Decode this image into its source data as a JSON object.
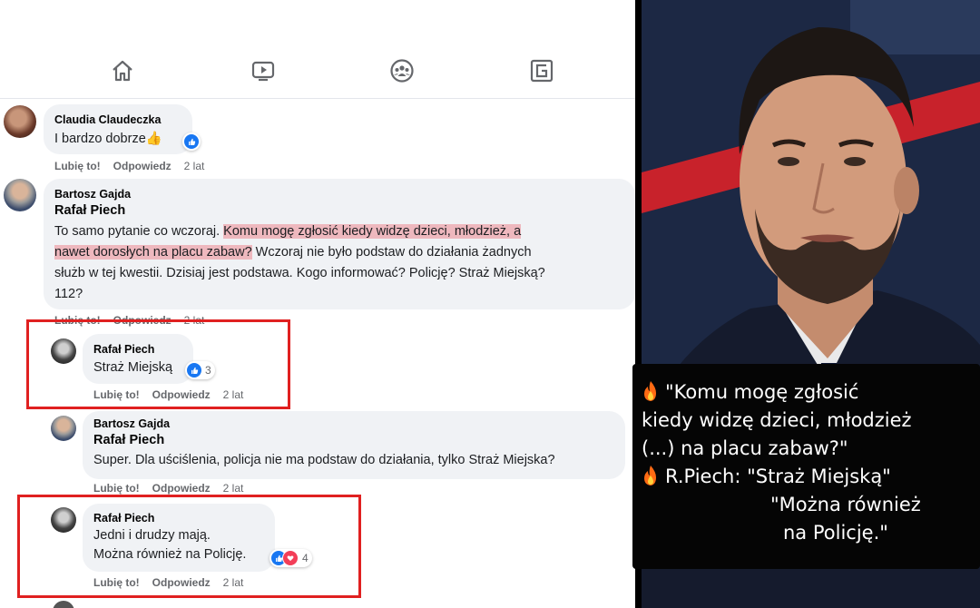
{
  "nav": {
    "icons": [
      "home-icon",
      "video-icon",
      "groups-icon",
      "gaming-icon"
    ]
  },
  "comments": [
    {
      "author": "Claudia Claudeczka",
      "text": "I bardzo dobrze👍",
      "actions": {
        "like": "Lubię to!",
        "reply": "Odpowiedz",
        "time": "2 lat"
      }
    },
    {
      "author": "Bartosz Gajda",
      "mention": "Rafał Piech",
      "lines": [
        "To samo pytanie co wczoraj.",
        "Komu mogę zgłosić kiedy widzę dzieci, młodzież, a",
        "nawet dorosłych na placu zabaw?",
        " Wczoraj nie było podstaw do działania żadnych",
        "służb w tej kwestii. Dzisiaj jest podstawa. Kogo informować? Policję? Straż Miejską?",
        "112?"
      ],
      "actions": {
        "like": "Lubię to!",
        "reply": "Odpowiedz",
        "time": "2 lat"
      }
    },
    {
      "author": "Rafał Piech",
      "text": "Straż Miejską",
      "reactions": "3",
      "actions": {
        "like": "Lubię to!",
        "reply": "Odpowiedz",
        "time": "2 lat"
      }
    },
    {
      "author": "Bartosz Gajda",
      "mention": "Rafał Piech",
      "text": "Super. Dla uściślenia, policja nie ma podstaw do działania, tylko Straż Miejska?",
      "actions": {
        "like": "Lubię to!",
        "reply": "Odpowiedz",
        "time": "2 lat"
      }
    },
    {
      "author": "Rafał Piech",
      "lines": [
        "Jedni i drudzy mają.",
        "Można również na Policję."
      ],
      "reactions": "4",
      "actions": {
        "like": "Lubię to!",
        "reply": "Odpowiedz",
        "time": "2 lat"
      }
    }
  ],
  "overlay": {
    "line1": "\"Komu mogę zgłosić",
    "line2": "kiedy widzę dzieci, młodzież",
    "line3": "(...) na placu zabaw?\"",
    "line4": "R.Piech: \"Straż Miejską\"",
    "line5": "\"Można również",
    "line6": "na Policję.\""
  },
  "colors": {
    "highlight": "#eb5a64",
    "redbox": "#e02020",
    "like": "#1877f2"
  }
}
